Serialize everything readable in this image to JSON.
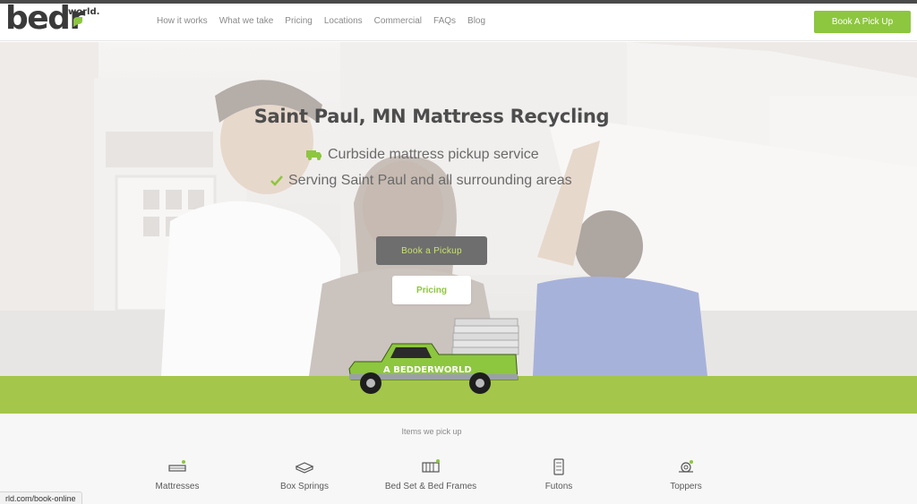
{
  "header": {
    "logo_text": "bedr",
    "logo_sup": "world.",
    "nav": [
      "How it works",
      "What we take",
      "Pricing",
      "Locations",
      "Commercial",
      "FAQs",
      "Blog"
    ],
    "cta_label": "Book A Pick Up"
  },
  "hero": {
    "title": "Saint Paul, MN Mattress Recycling",
    "line1": "Curbside mattress pickup service",
    "line2": "Serving Saint Paul and all surrounding areas",
    "book_label": "Book a Pickup",
    "pricing_label": "Pricing",
    "truck_text": "A BEDDERWORLD"
  },
  "items": {
    "title": "Items we pick up",
    "list": [
      {
        "label": "Mattresses",
        "icon": "mattress-icon"
      },
      {
        "label": "Box Springs",
        "icon": "box-spring-icon"
      },
      {
        "label": "Bed Set & Bed Frames",
        "icon": "bed-frame-icon"
      },
      {
        "label": "Futons",
        "icon": "futon-icon"
      },
      {
        "label": "Toppers",
        "icon": "topper-icon"
      }
    ]
  },
  "status_url": "rld.com/book-online",
  "colors": {
    "accent": "#8dc63f",
    "band": "#a4c64a",
    "dark_button": "#6e6e6e"
  }
}
